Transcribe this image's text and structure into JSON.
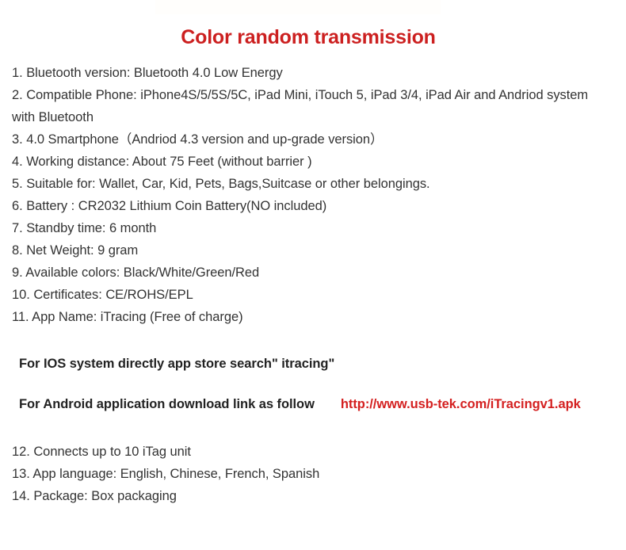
{
  "document": {
    "title": "Color random transmission",
    "title_color": "#cc2020",
    "body_text_color": "#333333",
    "background_color": "#ffffff"
  },
  "specs": [
    {
      "text": "1. Bluetooth version: Bluetooth 4.0 Low Energy"
    },
    {
      "text": "2. Compatible Phone: iPhone4S/5/5S/5C, iPad Mini, iTouch 5, iPad 3/4, iPad Air and Andriod system with Bluetooth"
    },
    {
      "text": "3. 4.0 Smartphone（Andriod 4.3 version and up-grade version）"
    },
    {
      "text": "4. Working distance: About 75 Feet (without barrier )"
    },
    {
      "text": "5. Suitable for: Wallet, Car, Kid, Pets, Bags,Suitcase or other belongings."
    },
    {
      "text": "6. Battery : CR2032 Lithium Coin Battery(NO included)"
    },
    {
      "text": "7. Standby time: 6 month"
    },
    {
      "text": "8. Net Weight: 9 gram"
    },
    {
      "text": "9. Available colors: Black/White/Green/Red"
    },
    {
      "text": "10. Certificates: CE/ROHS/EPL"
    },
    {
      "text": "11. App Name: iTracing (Free of charge)"
    }
  ],
  "notes": {
    "ios_line": "For IOS system directly app store search\" itracing\"",
    "android_label": "For Android application download link as follow",
    "android_url": "http://www.usb-tek.com/iTracingv1.apk",
    "url_color": "#d42020"
  },
  "specs_tail": [
    {
      "text": "12. Connects up to 10 iTag unit"
    },
    {
      "text": "13. App language: English, Chinese, French, Spanish"
    },
    {
      "text": "14. Package: Box packaging"
    }
  ]
}
